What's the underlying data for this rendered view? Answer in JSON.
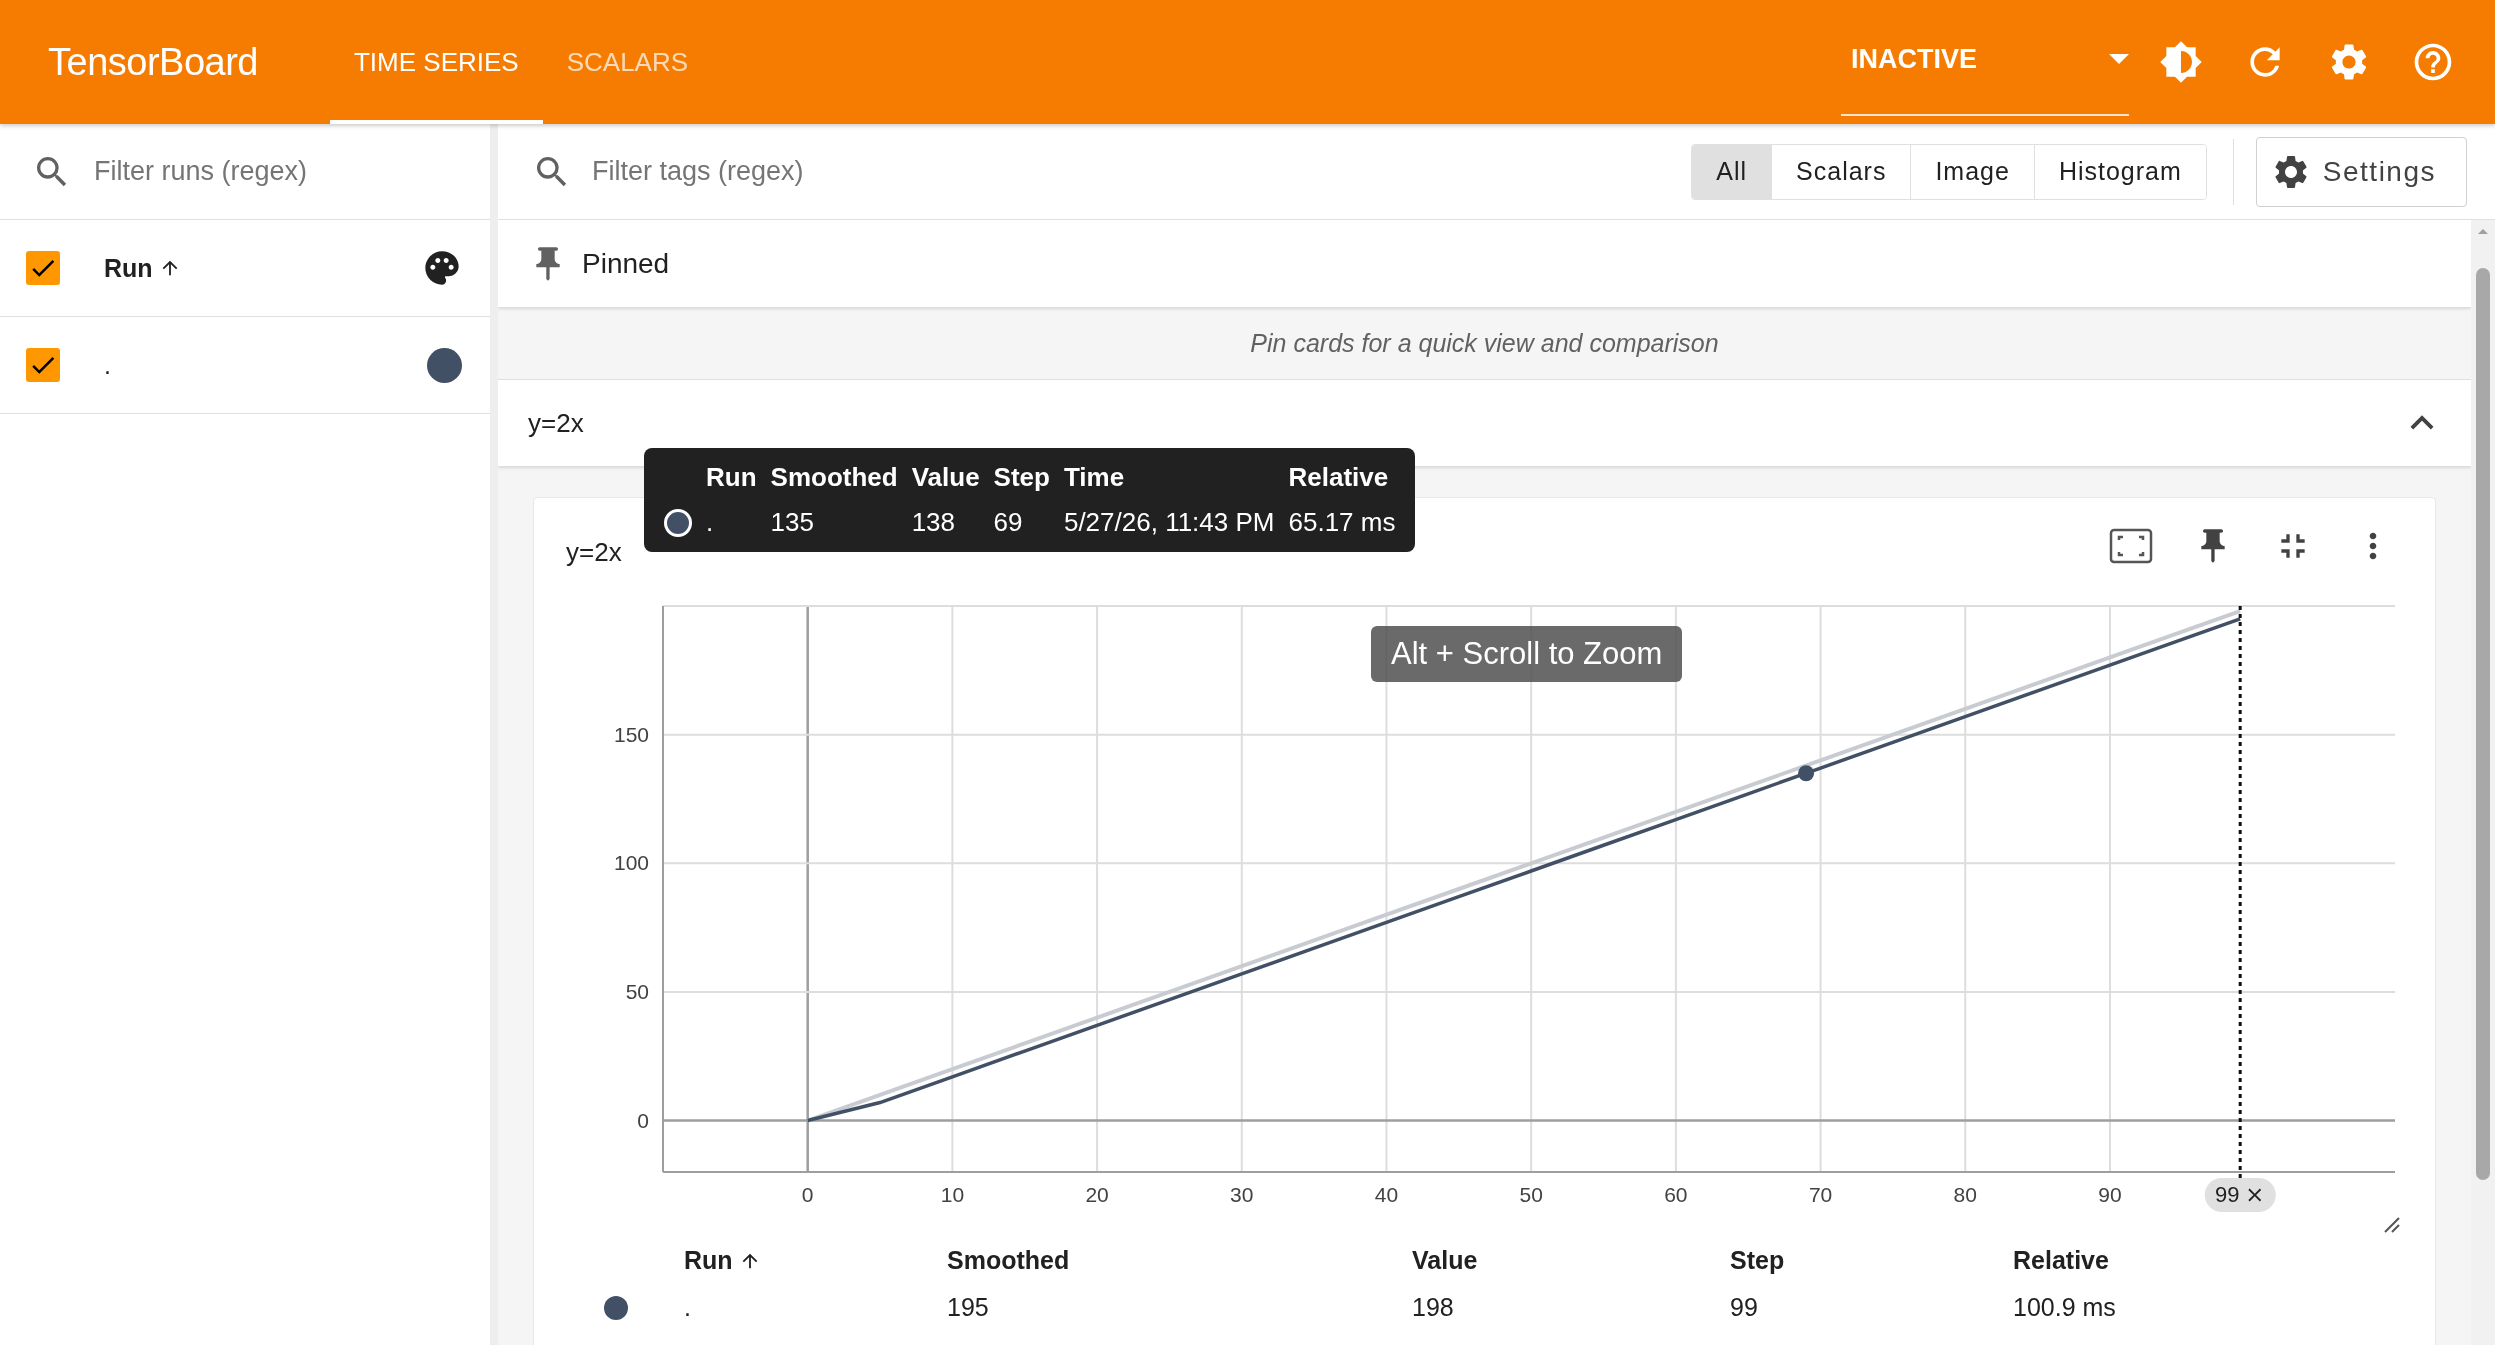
{
  "header": {
    "title": "TensorBoard",
    "tabs": [
      {
        "label": "TIME SERIES",
        "selected": true
      },
      {
        "label": "SCALARS",
        "selected": false
      }
    ],
    "reload_status": "INACTIVE"
  },
  "runs_panel": {
    "filter": {
      "placeholder": "Filter runs (regex)"
    },
    "header": {
      "label": "Run",
      "checked": true
    },
    "runs": [
      {
        "name": ".",
        "checked": true,
        "color": "#425066"
      }
    ]
  },
  "toolbar": {
    "filter": {
      "placeholder": "Filter tags (regex)"
    },
    "type_filters": [
      {
        "label": "All",
        "selected": true
      },
      {
        "label": "Scalars",
        "selected": false
      },
      {
        "label": "Image",
        "selected": false
      },
      {
        "label": "Histogram",
        "selected": false
      }
    ],
    "settings_button": "Settings"
  },
  "pinned": {
    "title": "Pinned",
    "empty_message": "Pin cards for a quick view and comparison"
  },
  "group": {
    "title": "y=2x",
    "expanded": true,
    "card": {
      "title": "y=2x",
      "tooltip": {
        "columns": [
          "Run",
          "Smoothed",
          "Value",
          "Step",
          "Time",
          "Relative"
        ],
        "rows": [
          {
            "run": ".",
            "smoothed": "135",
            "value": "138",
            "step": "69",
            "time": "5/27/26, 11:43 PM",
            "relative": "65.17 ms",
            "color": "#425066"
          }
        ]
      },
      "zoom_hint": "Alt + Scroll to Zoom",
      "step_marker": {
        "label": "99"
      },
      "chart_data": {
        "type": "line",
        "x": [
          0,
          5,
          10,
          15,
          20,
          25,
          30,
          35,
          40,
          45,
          50,
          55,
          60,
          65,
          70,
          75,
          80,
          85,
          90,
          95,
          99
        ],
        "series": [
          {
            "color": "#c8ccd2",
            "values": [
              0,
              10,
              20,
              30,
              40,
              50,
              60,
              70,
              80,
              90,
              100,
              110,
              120,
              130,
              140,
              150,
              160,
              170,
              180,
              190,
              198
            ]
          },
          {
            "color": "#425066",
            "values": [
              0,
              7,
              17,
              27,
              37,
              47,
              57,
              67,
              77,
              87,
              97,
              107,
              117,
              127,
              137,
              147,
              157,
              167,
              177,
              187,
              195
            ]
          }
        ],
        "xlim": [
          -10,
          109.7
        ],
        "ylim": [
          -20,
          200
        ],
        "xticks": [
          0,
          10,
          20,
          30,
          40,
          50,
          60,
          70,
          80,
          90
        ],
        "yticks": [
          0,
          50,
          100,
          150
        ],
        "grid": true,
        "ref_lines": [
          {
            "axis": "x",
            "value": 99,
            "color": "#111111"
          }
        ]
      },
      "table": {
        "columns": [
          "Run",
          "Smoothed",
          "Value",
          "Step",
          "Relative"
        ],
        "rows": [
          {
            "run": ".",
            "smoothed": "195",
            "value": "198",
            "step": "99",
            "relative": "100.9 ms",
            "color": "#425066"
          }
        ]
      }
    }
  }
}
